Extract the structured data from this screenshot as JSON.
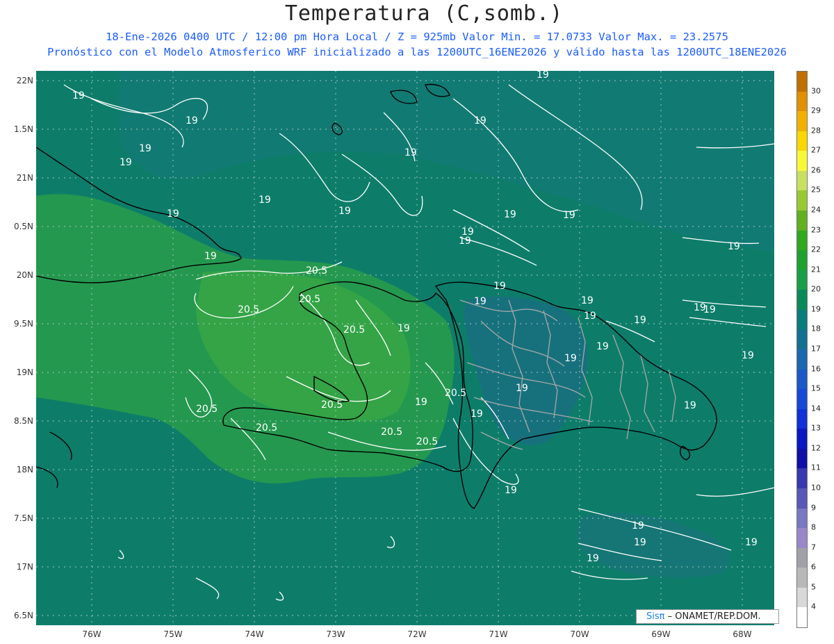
{
  "header": {
    "title": "Temperatura (C,somb.)",
    "subtitle_line1": "18-Ene-2026  0400 UTC / 12:00 pm Hora Local / Z = 925mb   Valor Min. = 17.0733  Valor Max. = 23.2575",
    "subtitle_line2": "Pronóstico con el Modelo Atmosferico WRF inicializado a las 1200UTC_16ENE2026 y válido hasta las  1200UTC_18ENE2026"
  },
  "map": {
    "lat_ticks": [
      "22N",
      "1.5N",
      "21N",
      "0.5N",
      "20N",
      "9.5N",
      "19N",
      "8.5N",
      "18N",
      "7.5N",
      "17N",
      "6.5N"
    ],
    "lon_ticks": [
      "76W",
      "75W",
      "74W",
      "73W",
      "72W",
      "71W",
      "70W",
      "69W",
      "68W"
    ],
    "contour_labels": [
      "19",
      "20.5"
    ],
    "colors": {
      "sea_base": "#0d7d6a",
      "cool_band": "#177878",
      "warm_land": "#2a9c4a",
      "warmer_land": "#3aaa45",
      "contour": "#ffffff",
      "coastline": "#000000",
      "province_border": "#a0a0a0"
    }
  },
  "colorbar": {
    "labels": [
      "30",
      "29",
      "28",
      "27",
      "26",
      "25",
      "24",
      "23",
      "22",
      "21",
      "20",
      "19",
      "18",
      "17",
      "16",
      "15",
      "14",
      "13",
      "12",
      "11",
      "10",
      "9",
      "8",
      "7",
      "6",
      "5",
      "4"
    ],
    "colors": [
      "#c07000",
      "#e09000",
      "#f0b000",
      "#f8d800",
      "#f8f838",
      "#c8e060",
      "#98c830",
      "#60b020",
      "#30a820",
      "#20a030",
      "#18a048",
      "#0a8a5a",
      "#0b7c7c",
      "#137090",
      "#1c68b0",
      "#1c58c8",
      "#1848d8",
      "#1030d8",
      "#0a18c0",
      "#1010a8",
      "#3838b0",
      "#5858b8",
      "#7878c0",
      "#9888c8",
      "#a0a0a8",
      "#b8b8b8",
      "#d8d8d8",
      "#ffffff"
    ]
  },
  "credit": {
    "brand": "Sisπ",
    "org": "– ONAMET/REP.DOM."
  }
}
